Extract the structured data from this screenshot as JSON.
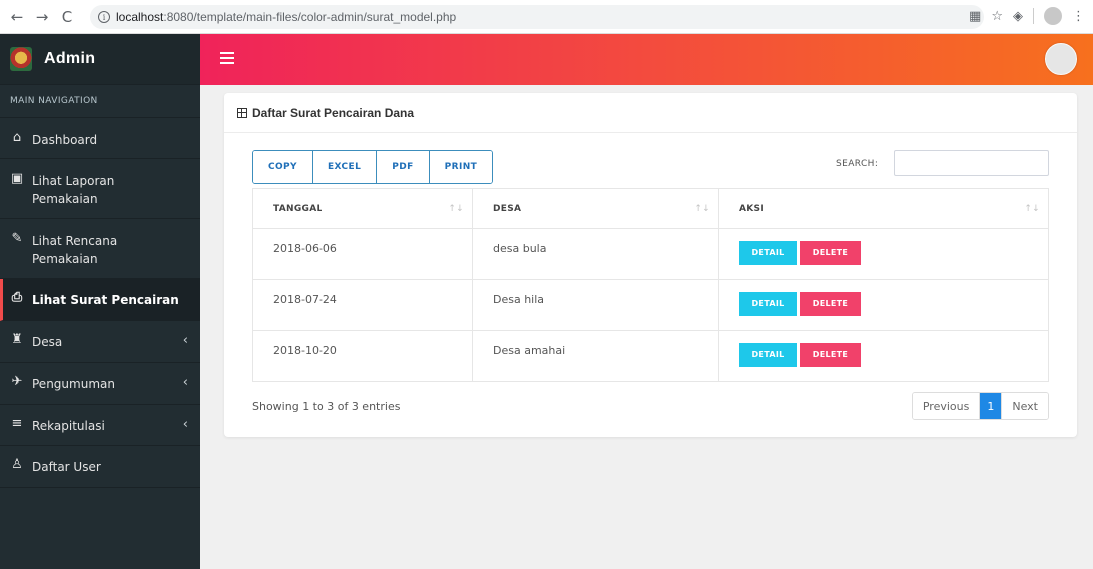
{
  "browser": {
    "url_host": "localhost",
    "url_path": ":8080/template/main-files/color-admin/surat_model.php",
    "back": "←",
    "forward": "→",
    "reload": "C",
    "info": "i"
  },
  "brand": {
    "title": "Admin"
  },
  "sidebar": {
    "header": "MAIN NAVIGATION",
    "items": [
      {
        "label": "Dashboard",
        "icon": "⌂"
      },
      {
        "label": "Lihat Laporan Pemakaian",
        "icon": "▣"
      },
      {
        "label": "Lihat Rencana Pemakaian",
        "icon": "✎"
      },
      {
        "label": "Lihat Surat Pencairan",
        "icon": "⎙"
      },
      {
        "label": "Desa",
        "icon": "♜",
        "chevron": "‹"
      },
      {
        "label": "Pengumuman",
        "icon": "✈",
        "chevron": "‹"
      },
      {
        "label": "Rekapitulasi",
        "icon": "≡",
        "chevron": "‹"
      },
      {
        "label": "Daftar User",
        "icon": "♙"
      }
    ]
  },
  "card": {
    "title": "Daftar Surat Pencairan Dana"
  },
  "export_buttons": [
    "COPY",
    "EXCEL",
    "PDF",
    "PRINT"
  ],
  "search": {
    "label": "SEARCH:",
    "value": ""
  },
  "table": {
    "columns": [
      "TANGGAL",
      "DESA",
      "AKSI"
    ],
    "sort_glyph": "↑↓",
    "rows": [
      {
        "tanggal": "2018-06-06",
        "desa": "desa bula"
      },
      {
        "tanggal": "2018-07-24",
        "desa": "Desa hila"
      },
      {
        "tanggal": "2018-10-20",
        "desa": "Desa amahai"
      }
    ],
    "detail_label": "DETAIL",
    "delete_label": "DELETE"
  },
  "footer": {
    "info": "Showing 1 to 3 of 3 entries",
    "previous": "Previous",
    "current_page": "1",
    "next": "Next"
  }
}
